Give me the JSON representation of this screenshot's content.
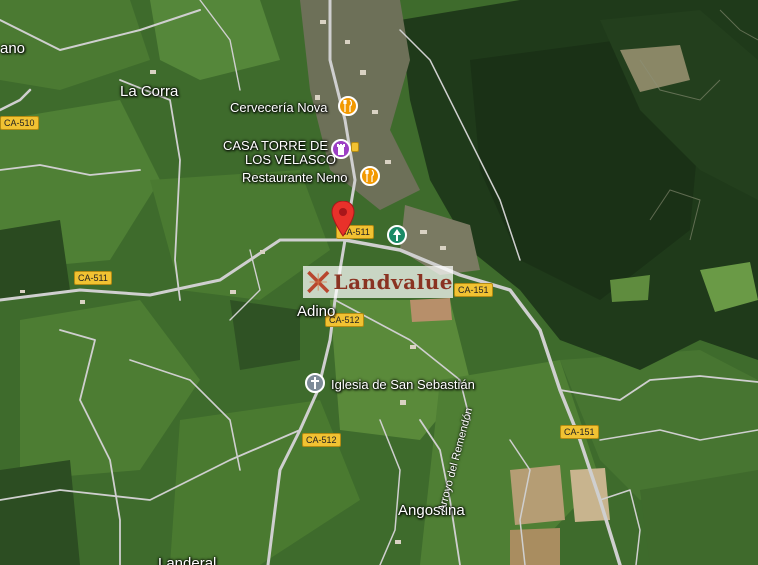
{
  "map": {
    "places": {
      "ano": "ano",
      "la_corra": "La Corra",
      "adino": "Adino",
      "angostina": "Angostina",
      "landeral": "Landeral"
    },
    "pois": {
      "cerveceria": "Cervecería Nova",
      "casa_torre_line1": "CASA TORRE DE",
      "casa_torre_line2": "LOS VELASCO",
      "restaurante": "Restaurante Neno",
      "iglesia": "Iglesia de San Sebastián"
    },
    "roads": {
      "ca510": "CA-510",
      "ca511_a": "CA-511",
      "ca511_b": "CA-511",
      "ca151_a": "CA-151",
      "ca151_b": "CA-151",
      "ca512_a": "CA-512",
      "ca512_b": "CA-512"
    },
    "street": "Arroyo del Remendón",
    "watermark": "Landvalue",
    "icons": [
      "food-icon",
      "monument-icon",
      "park-icon",
      "church-icon",
      "location-pin-icon"
    ],
    "colors": {
      "road_label_bg": "#f1c232",
      "food_pin": "#f29900",
      "monument_pin": "#9c3fc4",
      "park_pin": "#1a8a66",
      "church_pin": "#7d8b98",
      "location_pin": "#e8312a",
      "watermark_text": "#8a3322"
    }
  }
}
